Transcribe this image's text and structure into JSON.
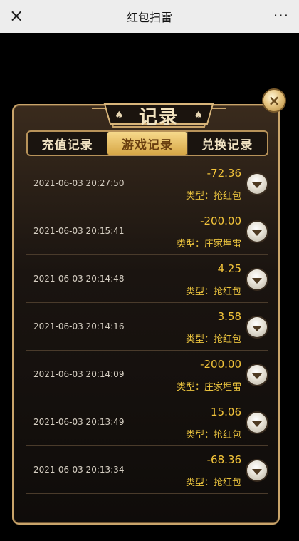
{
  "topbar": {
    "title": "红包扫雷",
    "close_icon": "×",
    "more_icon": "···"
  },
  "panel": {
    "title": "记录",
    "spade_icon": "♠",
    "close_icon": "×"
  },
  "tabs": [
    {
      "label": "充值记录",
      "active": false
    },
    {
      "label": "游戏记录",
      "active": true
    },
    {
      "label": "兑换记录",
      "active": false
    }
  ],
  "records": [
    {
      "time": "2021-06-03 20:27:50",
      "amount": "-72.36",
      "type": "类型：抢红包"
    },
    {
      "time": "2021-06-03 20:15:41",
      "amount": "-200.00",
      "type": "类型：庄家埋雷"
    },
    {
      "time": "2021-06-03 20:14:48",
      "amount": "4.25",
      "type": "类型：抢红包"
    },
    {
      "time": "2021-06-03 20:14:16",
      "amount": "3.58",
      "type": "类型：抢红包"
    },
    {
      "time": "2021-06-03 20:14:09",
      "amount": "-200.00",
      "type": "类型：庄家埋雷"
    },
    {
      "time": "2021-06-03 20:13:49",
      "amount": "15.06",
      "type": "类型：抢红包"
    },
    {
      "time": "2021-06-03 20:13:34",
      "amount": "-68.36",
      "type": "类型：抢红包"
    }
  ]
}
